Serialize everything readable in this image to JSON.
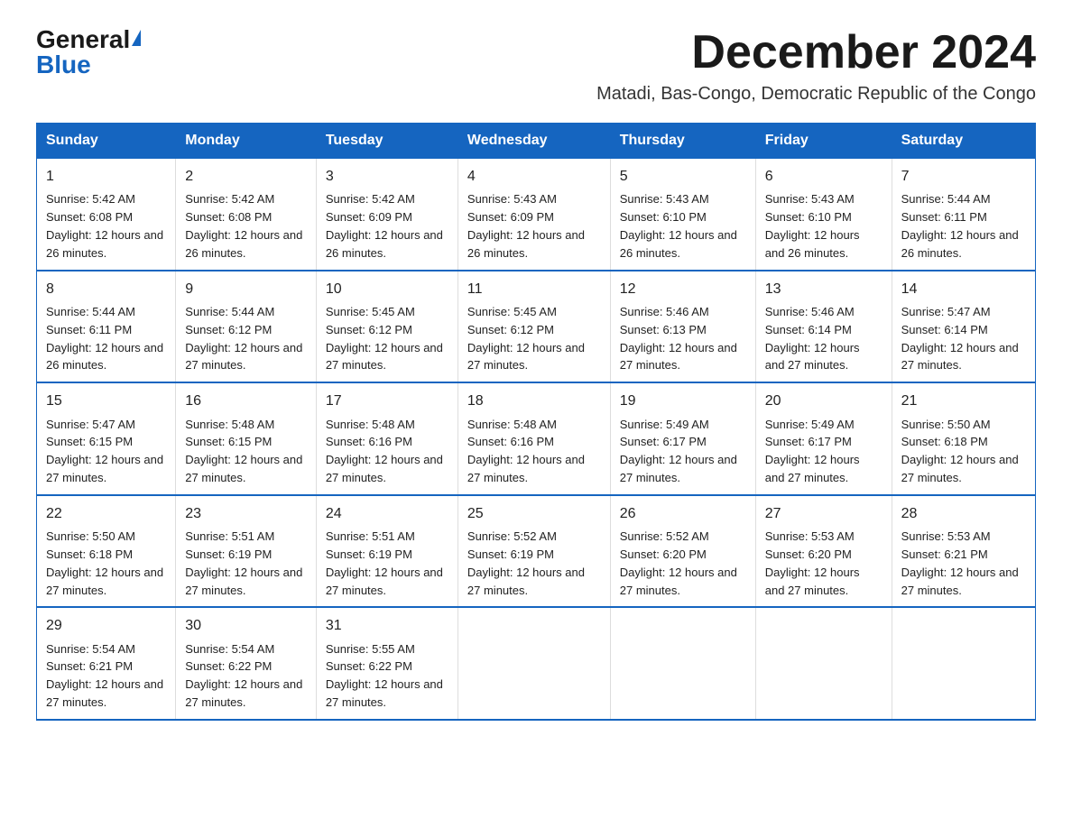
{
  "logo": {
    "general": "General",
    "blue": "Blue"
  },
  "title": "December 2024",
  "subtitle": "Matadi, Bas-Congo, Democratic Republic of the Congo",
  "days_of_week": [
    "Sunday",
    "Monday",
    "Tuesday",
    "Wednesday",
    "Thursday",
    "Friday",
    "Saturday"
  ],
  "weeks": [
    [
      {
        "day": "1",
        "sunrise": "5:42 AM",
        "sunset": "6:08 PM",
        "daylight": "12 hours and 26 minutes."
      },
      {
        "day": "2",
        "sunrise": "5:42 AM",
        "sunset": "6:08 PM",
        "daylight": "12 hours and 26 minutes."
      },
      {
        "day": "3",
        "sunrise": "5:42 AM",
        "sunset": "6:09 PM",
        "daylight": "12 hours and 26 minutes."
      },
      {
        "day": "4",
        "sunrise": "5:43 AM",
        "sunset": "6:09 PM",
        "daylight": "12 hours and 26 minutes."
      },
      {
        "day": "5",
        "sunrise": "5:43 AM",
        "sunset": "6:10 PM",
        "daylight": "12 hours and 26 minutes."
      },
      {
        "day": "6",
        "sunrise": "5:43 AM",
        "sunset": "6:10 PM",
        "daylight": "12 hours and 26 minutes."
      },
      {
        "day": "7",
        "sunrise": "5:44 AM",
        "sunset": "6:11 PM",
        "daylight": "12 hours and 26 minutes."
      }
    ],
    [
      {
        "day": "8",
        "sunrise": "5:44 AM",
        "sunset": "6:11 PM",
        "daylight": "12 hours and 26 minutes."
      },
      {
        "day": "9",
        "sunrise": "5:44 AM",
        "sunset": "6:12 PM",
        "daylight": "12 hours and 27 minutes."
      },
      {
        "day": "10",
        "sunrise": "5:45 AM",
        "sunset": "6:12 PM",
        "daylight": "12 hours and 27 minutes."
      },
      {
        "day": "11",
        "sunrise": "5:45 AM",
        "sunset": "6:12 PM",
        "daylight": "12 hours and 27 minutes."
      },
      {
        "day": "12",
        "sunrise": "5:46 AM",
        "sunset": "6:13 PM",
        "daylight": "12 hours and 27 minutes."
      },
      {
        "day": "13",
        "sunrise": "5:46 AM",
        "sunset": "6:14 PM",
        "daylight": "12 hours and 27 minutes."
      },
      {
        "day": "14",
        "sunrise": "5:47 AM",
        "sunset": "6:14 PM",
        "daylight": "12 hours and 27 minutes."
      }
    ],
    [
      {
        "day": "15",
        "sunrise": "5:47 AM",
        "sunset": "6:15 PM",
        "daylight": "12 hours and 27 minutes."
      },
      {
        "day": "16",
        "sunrise": "5:48 AM",
        "sunset": "6:15 PM",
        "daylight": "12 hours and 27 minutes."
      },
      {
        "day": "17",
        "sunrise": "5:48 AM",
        "sunset": "6:16 PM",
        "daylight": "12 hours and 27 minutes."
      },
      {
        "day": "18",
        "sunrise": "5:48 AM",
        "sunset": "6:16 PM",
        "daylight": "12 hours and 27 minutes."
      },
      {
        "day": "19",
        "sunrise": "5:49 AM",
        "sunset": "6:17 PM",
        "daylight": "12 hours and 27 minutes."
      },
      {
        "day": "20",
        "sunrise": "5:49 AM",
        "sunset": "6:17 PM",
        "daylight": "12 hours and 27 minutes."
      },
      {
        "day": "21",
        "sunrise": "5:50 AM",
        "sunset": "6:18 PM",
        "daylight": "12 hours and 27 minutes."
      }
    ],
    [
      {
        "day": "22",
        "sunrise": "5:50 AM",
        "sunset": "6:18 PM",
        "daylight": "12 hours and 27 minutes."
      },
      {
        "day": "23",
        "sunrise": "5:51 AM",
        "sunset": "6:19 PM",
        "daylight": "12 hours and 27 minutes."
      },
      {
        "day": "24",
        "sunrise": "5:51 AM",
        "sunset": "6:19 PM",
        "daylight": "12 hours and 27 minutes."
      },
      {
        "day": "25",
        "sunrise": "5:52 AM",
        "sunset": "6:19 PM",
        "daylight": "12 hours and 27 minutes."
      },
      {
        "day": "26",
        "sunrise": "5:52 AM",
        "sunset": "6:20 PM",
        "daylight": "12 hours and 27 minutes."
      },
      {
        "day": "27",
        "sunrise": "5:53 AM",
        "sunset": "6:20 PM",
        "daylight": "12 hours and 27 minutes."
      },
      {
        "day": "28",
        "sunrise": "5:53 AM",
        "sunset": "6:21 PM",
        "daylight": "12 hours and 27 minutes."
      }
    ],
    [
      {
        "day": "29",
        "sunrise": "5:54 AM",
        "sunset": "6:21 PM",
        "daylight": "12 hours and 27 minutes."
      },
      {
        "day": "30",
        "sunrise": "5:54 AM",
        "sunset": "6:22 PM",
        "daylight": "12 hours and 27 minutes."
      },
      {
        "day": "31",
        "sunrise": "5:55 AM",
        "sunset": "6:22 PM",
        "daylight": "12 hours and 27 minutes."
      },
      null,
      null,
      null,
      null
    ]
  ],
  "labels": {
    "sunrise_prefix": "Sunrise: ",
    "sunset_prefix": "Sunset: ",
    "daylight_prefix": "Daylight: "
  }
}
